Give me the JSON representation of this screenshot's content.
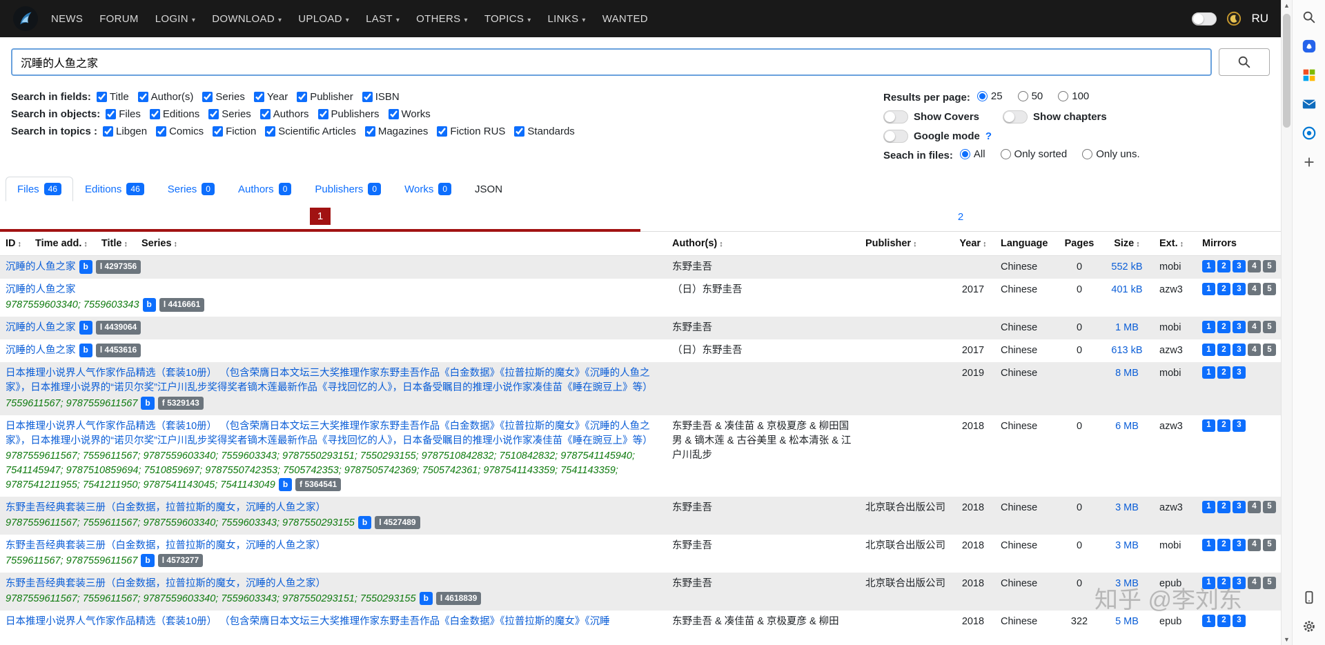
{
  "colors": {
    "accent": "#0d6efd",
    "pagination_red": "#a11212",
    "isbn_green": "#0e7a0e",
    "badge_gray": "#6c757d"
  },
  "navbar": {
    "items": [
      {
        "label": "NEWS",
        "dropdown": false
      },
      {
        "label": "FORUM",
        "dropdown": false
      },
      {
        "label": "LOGIN",
        "dropdown": true
      },
      {
        "label": "DOWNLOAD",
        "dropdown": true
      },
      {
        "label": "UPLOAD",
        "dropdown": true
      },
      {
        "label": "LAST",
        "dropdown": true
      },
      {
        "label": "OTHERS",
        "dropdown": true
      },
      {
        "label": "TOPICS",
        "dropdown": true
      },
      {
        "label": "LINKS",
        "dropdown": true
      },
      {
        "label": "WANTED",
        "dropdown": false
      }
    ],
    "language": "RU"
  },
  "search": {
    "value": "沉睡的人鱼之家"
  },
  "filters": [
    {
      "name": "fields",
      "label": "Search in fields:",
      "items": [
        {
          "label": "Title",
          "checked": true
        },
        {
          "label": "Author(s)",
          "checked": true
        },
        {
          "label": "Series",
          "checked": true
        },
        {
          "label": "Year",
          "checked": true
        },
        {
          "label": "Publisher",
          "checked": true
        },
        {
          "label": "ISBN",
          "checked": true
        }
      ]
    },
    {
      "name": "objects",
      "label": "Search in objects:",
      "items": [
        {
          "label": "Files",
          "checked": true
        },
        {
          "label": "Editions",
          "checked": true
        },
        {
          "label": "Series",
          "checked": true
        },
        {
          "label": "Authors",
          "checked": true
        },
        {
          "label": "Publishers",
          "checked": true
        },
        {
          "label": "Works",
          "checked": true
        }
      ]
    },
    {
      "name": "topics",
      "label": "Search in topics :",
      "items": [
        {
          "label": "Libgen",
          "checked": true
        },
        {
          "label": "Comics",
          "checked": true
        },
        {
          "label": "Fiction",
          "checked": true
        },
        {
          "label": "Scientific Articles",
          "checked": true
        },
        {
          "label": "Magazines",
          "checked": true
        },
        {
          "label": "Fiction RUS",
          "checked": true
        },
        {
          "label": "Standards",
          "checked": true
        }
      ]
    }
  ],
  "options": {
    "results_per_page": {
      "label": "Results per page:",
      "options": [
        {
          "label": "25",
          "selected": true
        },
        {
          "label": "50",
          "selected": false
        },
        {
          "label": "100",
          "selected": false
        }
      ]
    },
    "toggles": [
      {
        "label": "Show Covers",
        "on": false
      },
      {
        "label": "Show chapters",
        "on": false
      }
    ],
    "google_mode": {
      "label": "Google mode",
      "help": "?",
      "on": false
    },
    "files_filter": {
      "label": "Seach in files:",
      "options": [
        {
          "label": "All",
          "selected": true
        },
        {
          "label": "Only sorted",
          "selected": false
        },
        {
          "label": "Only uns.",
          "selected": false
        }
      ]
    }
  },
  "tabs": [
    {
      "label": "Files",
      "count": "46",
      "active": true
    },
    {
      "label": "Editions",
      "count": "46",
      "active": false
    },
    {
      "label": "Series",
      "count": "0",
      "active": false
    },
    {
      "label": "Authors",
      "count": "0",
      "active": false
    },
    {
      "label": "Publishers",
      "count": "0",
      "active": false
    },
    {
      "label": "Works",
      "count": "0",
      "active": false
    },
    {
      "label": "JSON",
      "count": null,
      "active": false
    }
  ],
  "pagination": {
    "current": "1",
    "next": "2"
  },
  "table": {
    "header_left": [
      {
        "label": "ID",
        "sort": true
      },
      {
        "label": "Time add.",
        "sort": true
      },
      {
        "label": "Title",
        "sort": true
      },
      {
        "label": "Series",
        "sort": true
      }
    ],
    "columns": [
      {
        "label": "Author(s)",
        "sort": true,
        "align": "left"
      },
      {
        "label": "Publisher",
        "sort": true,
        "align": "left"
      },
      {
        "label": "Year",
        "sort": true,
        "align": "center"
      },
      {
        "label": "Language",
        "sort": false,
        "align": "left"
      },
      {
        "label": "Pages",
        "sort": false,
        "align": "center"
      },
      {
        "label": "Size",
        "sort": true,
        "align": "center"
      },
      {
        "label": "Ext.",
        "sort": true,
        "align": "left"
      },
      {
        "label": "Mirrors",
        "sort": false,
        "align": "left"
      }
    ],
    "rows": [
      {
        "title": "沉睡的人鱼之家",
        "isbn": "",
        "badge_b": "b",
        "id_badge": "l 4297356",
        "author": "东野圭吾",
        "publisher": "",
        "year": "",
        "language": "Chinese",
        "pages": "0",
        "size": "552 kB",
        "ext": "mobi",
        "mirrors": 5
      },
      {
        "title": "沉睡的人鱼之家",
        "isbn": "9787559603340; 7559603343",
        "badge_b": "b",
        "id_badge": "l 4416661",
        "author": "（日）东野圭吾",
        "publisher": "",
        "year": "2017",
        "language": "Chinese",
        "pages": "0",
        "size": "401 kB",
        "ext": "azw3",
        "mirrors": 5
      },
      {
        "title": "沉睡的人鱼之家",
        "isbn": "",
        "badge_b": "b",
        "id_badge": "l 4439064",
        "author": "东野圭吾",
        "publisher": "",
        "year": "",
        "language": "Chinese",
        "pages": "0",
        "size": "1 MB",
        "ext": "mobi",
        "mirrors": 5
      },
      {
        "title": "沉睡的人鱼之家",
        "isbn": "",
        "badge_b": "b",
        "id_badge": "l 4453616",
        "author": "（日）东野圭吾",
        "publisher": "",
        "year": "2017",
        "language": "Chinese",
        "pages": "0",
        "size": "613 kB",
        "ext": "azw3",
        "mirrors": 5
      },
      {
        "title": "日本推理小说界人气作家作品精选（套装10册） （包含荣膺日本文坛三大奖推理作家东野圭吾作品《白金数据》《拉普拉斯的魔女》《沉睡的人鱼之家》，日本推理小说界的“诺贝尔奖”江户川乱步奖得奖者镝木莲最新作品《寻找回忆的人》，日本备受瞩目的推理小说作家凑佳苗《睡在豌豆上》等）",
        "isbn": "7559611567; 9787559611567",
        "badge_b": "b",
        "id_badge": "f 5329143",
        "author": "",
        "publisher": "",
        "year": "2019",
        "language": "Chinese",
        "pages": "",
        "size": "8 MB",
        "ext": "mobi",
        "mirrors": 3
      },
      {
        "title": "日本推理小说界人气作家作品精选（套装10册） （包含荣膺日本文坛三大奖推理作家东野圭吾作品《白金数据》《拉普拉斯的魔女》《沉睡的人鱼之家》，日本推理小说界的“诺贝尔奖”江户川乱步奖得奖者镝木莲最新作品《寻找回忆的人》，日本备受瞩目的推理小说作家凑佳苗《睡在豌豆上》等）",
        "isbn": "9787559611567; 7559611567; 9787559603340; 7559603343; 9787550293151; 7550293155; 9787510842832; 7510842832; 9787541145940; 7541145947; 9787510859694; 7510859697; 9787550742353; 7505742353; 9787505742369; 7505742361; 9787541143359; 7541143359; 9787541211955; 7541211950; 9787541143045; 7541143049",
        "badge_b": "b",
        "id_badge": "f 5364541",
        "author": "东野圭吾 & 凑佳苗 & 京极夏彦 & 柳田国男 & 镝木莲 & 古谷美里 & 松本清张 & 江户川乱步",
        "publisher": "",
        "year": "2018",
        "language": "Chinese",
        "pages": "0",
        "size": "6 MB",
        "ext": "azw3",
        "mirrors": 3
      },
      {
        "title": "东野圭吾经典套装三册（白金数据，拉普拉斯的魔女，沉睡的人鱼之家）",
        "isbn": "9787559611567; 7559611567; 9787559603340; 7559603343; 9787550293155",
        "badge_b": "b",
        "id_badge": "l 4527489",
        "author": "东野圭吾",
        "publisher": "北京联合出版公司",
        "year": "2018",
        "language": "Chinese",
        "pages": "0",
        "size": "3 MB",
        "ext": "azw3",
        "mirrors": 5
      },
      {
        "title": "东野圭吾经典套装三册（白金数据，拉普拉斯的魔女，沉睡的人鱼之家）",
        "isbn": "7559611567; 9787559611567",
        "badge_b": "b",
        "id_badge": "l 4573277",
        "author": "东野圭吾",
        "publisher": "北京联合出版公司",
        "year": "2018",
        "language": "Chinese",
        "pages": "0",
        "size": "3 MB",
        "ext": "mobi",
        "mirrors": 5
      },
      {
        "title": "东野圭吾经典套装三册（白金数据，拉普拉斯的魔女，沉睡的人鱼之家）",
        "isbn": "9787559611567; 7559611567; 9787559603340; 7559603343; 9787550293151; 7550293155",
        "badge_b": "b",
        "id_badge": "l 4618839",
        "author": "东野圭吾",
        "publisher": "北京联合出版公司",
        "year": "2018",
        "language": "Chinese",
        "pages": "0",
        "size": "3 MB",
        "ext": "epub",
        "mirrors": 5
      },
      {
        "title": "日本推理小说界人气作家作品精选（套装10册） （包含荣膺日本文坛三大奖推理作家东野圭吾作品《白金数据》《拉普拉斯的魔女》《沉睡",
        "isbn": "",
        "badge_b": "",
        "id_badge": "",
        "author": "东野圭吾 & 凑佳苗 & 京极夏彦 & 柳田",
        "publisher": "",
        "year": "2018",
        "language": "Chinese",
        "pages": "322",
        "size": "5 MB",
        "ext": "epub",
        "mirrors": 3
      }
    ]
  },
  "watermark": "知乎 @李刘东",
  "browser_sidebar": {
    "icons_top": [
      "search-icon",
      "copilot-icon",
      "microsoft-365-icon",
      "outlook-icon",
      "edge-discover-icon",
      "add-icon"
    ],
    "icons_bottom": [
      "phone-link-icon",
      "settings-gear-icon"
    ]
  }
}
